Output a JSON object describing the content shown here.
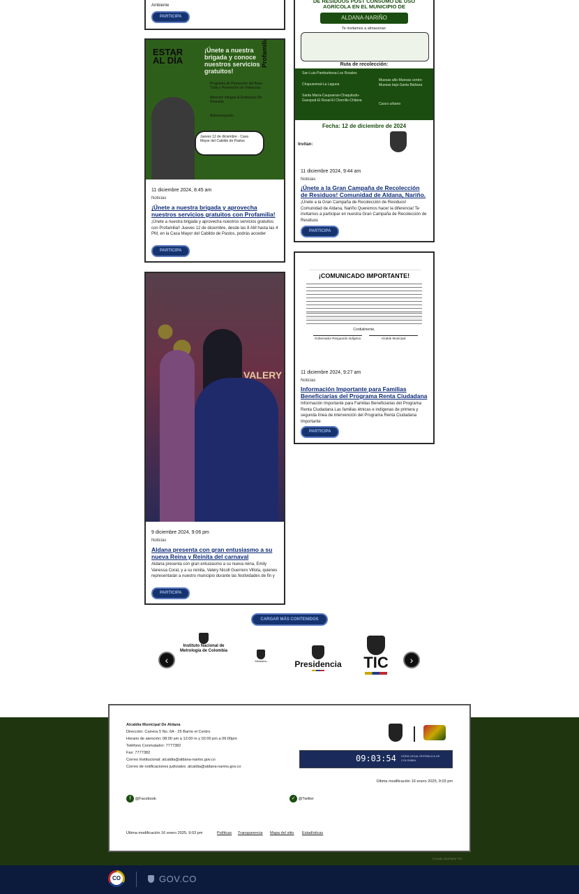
{
  "cards": [
    {
      "id": "top-left-partial",
      "desc_tail": "Ambiente",
      "button": "PARTICIPA"
    },
    {
      "id": "estar-al-dia",
      "image": {
        "brand": "ESTAR AL DÍA",
        "heading": "¡Únete a nuestra brigada y conoce nuestros servicios gratuitos!",
        "side_brand": "Profamilia",
        "services": [
          "Programa de Promoción del Buen Trato y Prevención de Violencias",
          "Atención integral al Embarazo No Deseado",
          "Anticoncepción"
        ],
        "details": "Jueves 12 de diciembre · Casa Mayor del Cabildo de Pastos"
      },
      "date": "11 diciembre 2024, 8:45 am",
      "tag": "Noticias",
      "title": "¡Únete a nuestra brigada y aprovecha nuestros servicios gratuitos con Profamilia!",
      "desc": "¡Únete a nuestra brigada y aprovecha nuestros servicios gratuitos con Profamilia!! Jueves 12 de diciembre, desde las 8 AM hasta las 4 PM, en la Casa Mayor del Cabildo de Pastos, podrás acceder",
      "button": "PARTICIPA"
    },
    {
      "id": "recoleccion",
      "image": {
        "heading": "DE RESIDUOS POST CONSUMO DE USO AGRÍCOLA EN EL MUNICIPIO DE",
        "town": "ALDANA-NARIÑO",
        "invite": "Te invitamos a almacenar:",
        "route_title": "Ruta de recolección:",
        "routes": [
          "San Luis-Pambarbosa-Los Rosales",
          "Chapuesmal-La Laguna",
          "Santa María-Caupueran-Chaquitudo-Guespud-El Rosal-El Chorrillo-Chitana",
          "Muesas alto-Muesas centro-Muesas bajo-Santa Bárbara",
          "Casco urbano"
        ],
        "date": "Fecha: 12 de diciembre de 2024",
        "invites": "Invitan:"
      },
      "date": "11 diciembre 2024, 9:44 am",
      "tag": "Noticias",
      "title": "¡Únete a la Gran Campaña de Recolección de Residuos! Comunidad de Aldana, Nariño.",
      "desc": "¡Únete a la Gran Campaña de Recolección de Residuos! Comunidad de Aldana, Nariño Queremos hacer la diferencia! Te invitamos a participar en nuestra Gran Campaña de Recolección de Residuos",
      "button": "PARTICIPA"
    },
    {
      "id": "comunicado",
      "image": {
        "heading": "¡COMUNICADO IMPORTANTE!",
        "subheading": "Cordialmente,",
        "sign_left": "Gobernador Resguardo Indígena",
        "sign_right": "Alcalde Municipal"
      },
      "date": "11 diciembre 2024, 9:27 am",
      "tag": "Noticias",
      "title": "Información Importante para Familias Beneficiarias del Programa Renta Ciudadana",
      "desc": "Información Importante para Familias Beneficiarias del Programa Renta Ciudadana Las familias étnicas e indígenas de primera y segunda línea de intervención del Programa Renta Ciudadana Importante",
      "button": "PARTICIPA"
    },
    {
      "id": "reina",
      "image": {
        "banner": "VALERY"
      },
      "date": "9 diciembre 2024, 9:06 pm",
      "tag": "Noticias",
      "title": "Aldana presenta con gran entusiasmo a su nueva Reina y Reinita del carnaval",
      "desc": "Aldana presenta con gran entusiasmo a su nueva reina, Emily Vanessa Coral, y a su reinita, Valery Nicoll Guerrero Villota, quienes representarán a nuestro municipio durante las festividades de fin y",
      "button": "PARTICIPA"
    }
  ],
  "load_more": "CARGAR MÁS CONTENIDOS",
  "carousel": {
    "prev": "‹",
    "next": "›",
    "logos": [
      {
        "name": "Instituto Nacional de Metrología de Colombia",
        "icon": "shield-icon"
      },
      {
        "name": "Ministerio",
        "icon": "shield-icon"
      },
      {
        "name": "Presidencia",
        "icon": "coat-of-arms-icon"
      },
      {
        "name": "TIC",
        "icon": "coat-of-arms-icon"
      }
    ]
  },
  "footer": {
    "lines": [
      "Alcaldía Municipal De Aldana",
      "Dirección: Carrera 5 No. 6A - 25 Barrio el Centro",
      "Horario de atención: 08:00 am a 12:00 m y 02:00 pm a 06:00pm",
      "Teléfono Conmutador: 7777382",
      "Fax: 7777382",
      "Correo Institucional: alcaldia@aldana-narino.gov.co",
      "Correo de notificaciones judiciales: alcaldia@aldana-narino.gov.co"
    ],
    "clock": "09:03:54",
    "clock_label": "HORA LEGAL REPÚBLICA DE COLOMBIA",
    "last_mod_right": "Última modificación 16 enero 2025, 9:03 pm",
    "social": [
      {
        "label": "@Facebook",
        "icon": "facebook-icon"
      },
      {
        "label": "@Twitter",
        "icon": "twitter-icon"
      }
    ],
    "last_mod_left": "Última modificación 16 enero 2025, 9:03 pm",
    "links": [
      "Políticas",
      "Transparencia",
      "Mapa del sitio",
      "Estadísticas"
    ],
    "credit": "Creado diseñado TIC"
  },
  "govbar": {
    "co": "CO",
    "govco": "GOV.CO"
  }
}
